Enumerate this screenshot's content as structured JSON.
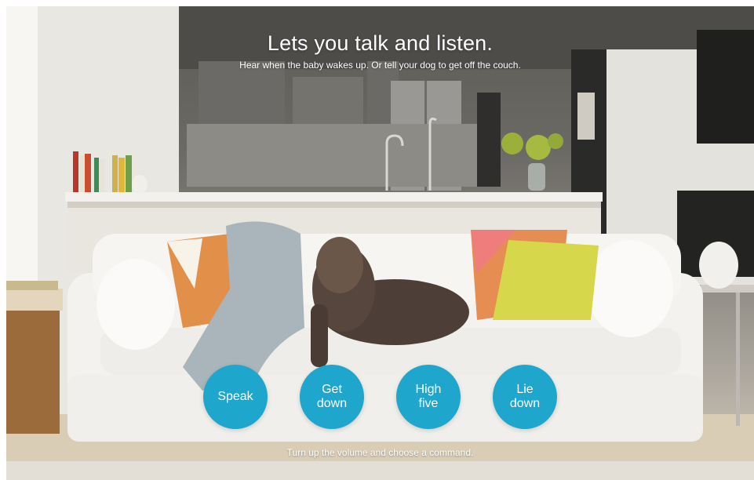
{
  "hero": {
    "headline": "Lets you talk and listen.",
    "subhead": "Hear when the baby wakes up. Or tell your dog to get off the couch."
  },
  "commands": [
    {
      "label": "Speak"
    },
    {
      "label": "Get\ndown"
    },
    {
      "label": "High\nfive"
    },
    {
      "label": "Lie\ndown"
    }
  ],
  "footer": {
    "hint": "Turn up the volume and choose a command."
  },
  "colors": {
    "button": "#1fa6cc",
    "text": "#ffffff"
  }
}
